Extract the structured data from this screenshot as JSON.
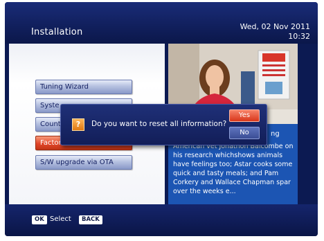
{
  "header": {
    "title": "Installation",
    "date": "Wed, 02 Nov 2011",
    "time": "10:32"
  },
  "menu": {
    "items": [
      {
        "label": "Tuning Wizard"
      },
      {
        "label": "Syste"
      },
      {
        "label": "Count"
      },
      {
        "label": "Factor"
      },
      {
        "label": "S/W upgrade via OTA"
      }
    ],
    "selected_index": 3
  },
  "preview": {
    "description_partial_title": "ng",
    "description": "American vet Jonathon Balcombe on his research whichshows animals have feelings too; Astar cooks some quick and tasty meals; and Pam Corkery and Wallace Chapman spar over the weeks e..."
  },
  "dialog": {
    "question": "Do you want to reset all information?",
    "icon": "question-icon",
    "yes_label": "Yes",
    "no_label": "No"
  },
  "footer": {
    "ok_key": "OK",
    "select_label": "Select",
    "back_key": "BACK"
  },
  "colors": {
    "background": "#0c1a52",
    "selected": "#e2462a",
    "description_bg": "#1c55b3"
  }
}
